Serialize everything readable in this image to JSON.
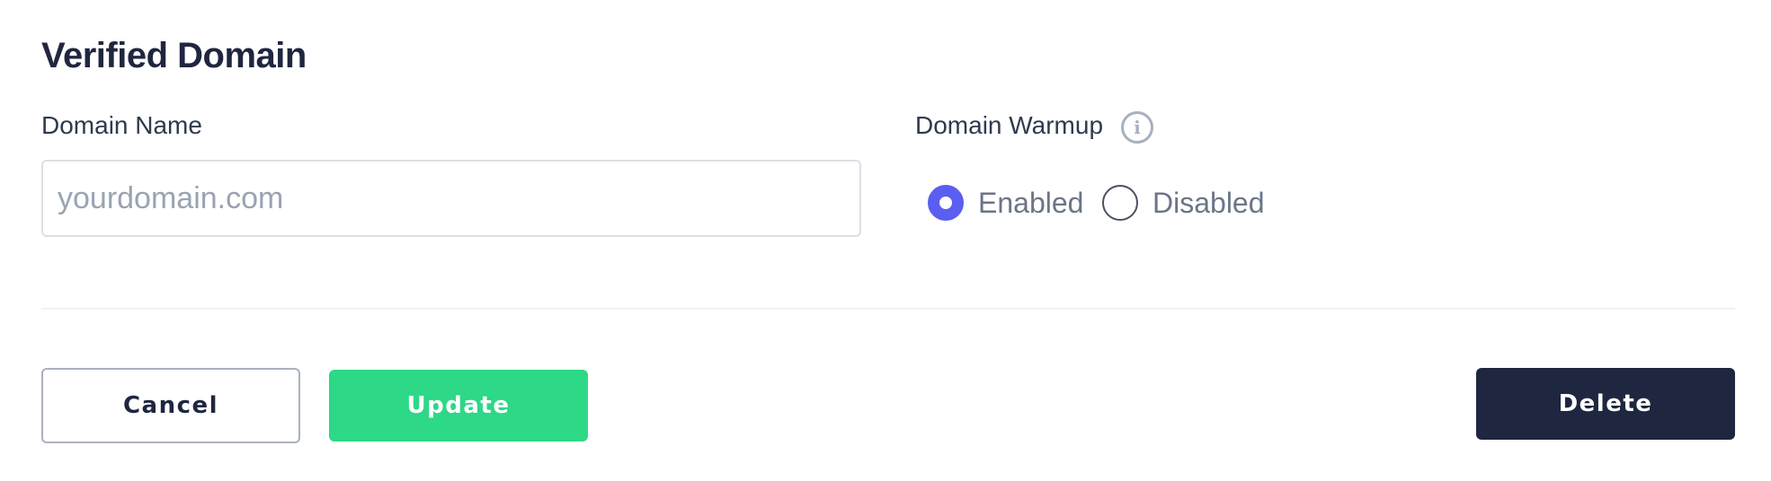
{
  "page": {
    "title": "Verified Domain"
  },
  "domain_name": {
    "label": "Domain Name",
    "value": "",
    "placeholder": "yourdomain.com"
  },
  "domain_warmup": {
    "label": "Domain Warmup",
    "info_icon": "info-icon",
    "options": [
      {
        "label": "Enabled",
        "selected": true
      },
      {
        "label": "Disabled",
        "selected": false
      }
    ]
  },
  "actions": {
    "cancel_label": "Cancel",
    "update_label": "Update",
    "delete_label": "Delete"
  },
  "colors": {
    "title": "#1f2640",
    "accent_radio": "#5b5ef0",
    "update_button": "#2dd886",
    "delete_button": "#1f2640"
  }
}
